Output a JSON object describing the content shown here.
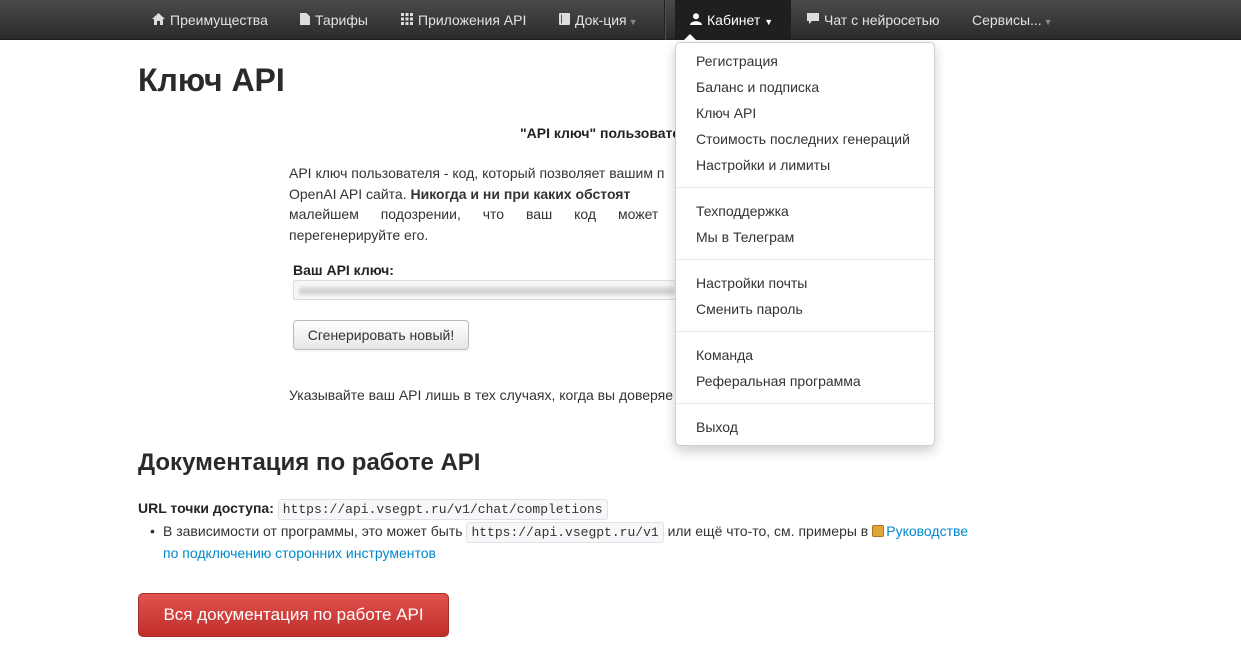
{
  "navbar": {
    "items": [
      {
        "label": "Преимущества",
        "icon": "home-icon"
      },
      {
        "label": "Тарифы",
        "icon": "file-icon"
      },
      {
        "label": "Приложения API",
        "icon": "grid-icon"
      },
      {
        "label": "Док-ция",
        "icon": "book-icon"
      },
      {
        "label": "Кабинет",
        "icon": "user-icon"
      },
      {
        "label": "Чат с нейросетью",
        "icon": "chat-icon"
      },
      {
        "label": "Сервисы..."
      }
    ]
  },
  "page": {
    "title": "Ключ API",
    "center_title": "\"API ключ\" пользовате",
    "intro": {
      "line1": "API ключ пользователя - код, который позволяет вашим п",
      "line2_plain": "OpenAI API сайта. ",
      "line2_bold": "Никогда и ни при каких обстоят",
      "line3": "малейшем подозрении, что ваш код может ис",
      "line4": "перегенерируйте его."
    },
    "key_label": "Ваш API ключ:",
    "generate_button": "Сгенерировать новый!",
    "warning_text": "Указывайте ваш API лишь в тех случаях, когда вы доверяе"
  },
  "docs": {
    "title": "Документация по работе API",
    "url_label": "URL точки доступа:",
    "url": "https://api.vsegpt.ru/v1/chat/completions",
    "bullet_text1": "В зависимости от программы, это может быть",
    "base_url": "https://api.vsegpt.ru/v1",
    "bullet_text2": "или ещё что-то, см. примеры в",
    "guide_link_line1": "Руководстве",
    "guide_link_line2": "по подключению сторонних инструментов",
    "all_docs_button": "Вся документация по работе API"
  },
  "dropdown": {
    "groups": [
      [
        "Регистрация",
        "Баланс и подписка",
        "Ключ API",
        "Стоимость последних генераций",
        "Настройки и лимиты"
      ],
      [
        "Техподдержка",
        "Мы в Телеграм"
      ],
      [
        "Настройки почты",
        "Сменить пароль"
      ],
      [
        "Команда",
        "Реферальная программа"
      ],
      [
        "Выход"
      ]
    ]
  },
  "colors": {
    "navbar_bg": "#2b2b2b",
    "link": "#0088cc",
    "danger_button": "#c9302c"
  }
}
